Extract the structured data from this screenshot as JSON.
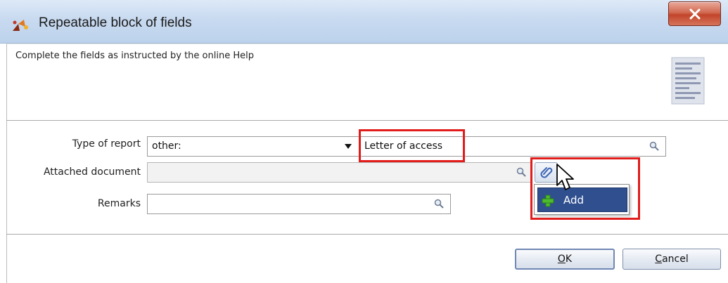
{
  "window": {
    "title": "Repeatable block of fields",
    "close_glyph": "X"
  },
  "help": {
    "text": "Complete the fields as instructed by the online Help"
  },
  "form": {
    "type_of_report": {
      "label": "Type of report",
      "selected": "other:",
      "free_text": "Letter of access"
    },
    "attached_document": {
      "label": "Attached document",
      "value": ""
    },
    "remarks": {
      "label": "Remarks",
      "value": ""
    }
  },
  "attach_menu": {
    "items": [
      {
        "label": "Add",
        "icon": "green-plus-icon"
      }
    ]
  },
  "buttons": {
    "ok": {
      "mnemonic": "O",
      "rest": "K"
    },
    "cancel": {
      "mnemonic": "C",
      "rest": "ancel"
    }
  },
  "colors": {
    "highlight_box": "#e21b1b",
    "menu_selected": "#2f4f8f",
    "close_button": "#c2452a"
  },
  "icons": {
    "app": "app-logo-icon",
    "close": "close-icon",
    "help_document": "document-lines-icon",
    "search": "magnifier-icon",
    "attach": "paperclip-icon",
    "dropdown": "dropdown-arrow-icon",
    "cursor": "mouse-pointer-icon"
  }
}
